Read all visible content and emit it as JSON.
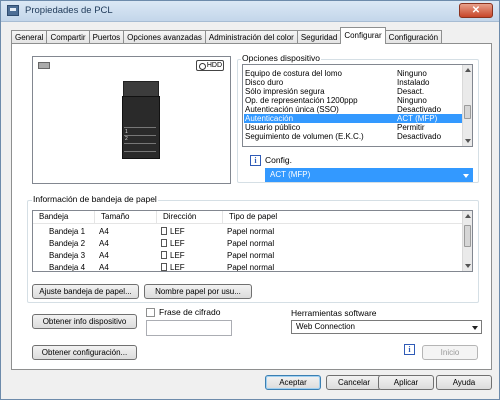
{
  "window": {
    "title": "Propiedades de PCL",
    "close_glyph": "✕"
  },
  "tabs": [
    {
      "label": "General"
    },
    {
      "label": "Compartir"
    },
    {
      "label": "Puertos"
    },
    {
      "label": "Opciones avanzadas"
    },
    {
      "label": "Administración del color"
    },
    {
      "label": "Seguridad"
    },
    {
      "label": "Configurar",
      "active": true
    },
    {
      "label": "Configuración"
    }
  ],
  "device_preview": {
    "hdd_badge": "HDD",
    "icons": [
      "printer-image",
      "hdd-icon"
    ]
  },
  "device_options": {
    "group_label": "Opciones dispositivo",
    "rows": [
      {
        "name": "Equipo de costura del lomo",
        "value": "Ninguno"
      },
      {
        "name": "Disco duro",
        "value": "Instalado"
      },
      {
        "name": "Sólo impresión segura",
        "value": "Desact."
      },
      {
        "name": "Op. de representación 1200ppp",
        "value": "Ninguno"
      },
      {
        "name": "Autenticación única (SSO)",
        "value": "Desactivado"
      },
      {
        "name": "Autenticación",
        "value": "ACT (MFP)",
        "selected": true
      },
      {
        "name": "Usuario público",
        "value": "Permitir"
      },
      {
        "name": "Seguimiento de volumen (E.K.C.)",
        "value": "Desactivado"
      }
    ],
    "config_label": "Config.",
    "config_value": "ACT (MFP)"
  },
  "paper_tray": {
    "group_label": "Información de bandeja de papel",
    "columns": [
      "Bandeja",
      "Tamaño",
      "Dirección",
      "Tipo de papel"
    ],
    "rows": [
      {
        "tray": "Bandeja 1",
        "size": "A4",
        "direction": "LEF",
        "type": "Papel normal"
      },
      {
        "tray": "Bandeja 2",
        "size": "A4",
        "direction": "LEF",
        "type": "Papel normal"
      },
      {
        "tray": "Bandeja 3",
        "size": "A4",
        "direction": "LEF",
        "type": "Papel normal"
      },
      {
        "tray": "Bandeja 4",
        "size": "A4",
        "direction": "LEF",
        "type": "Papel normal"
      }
    ],
    "adjust_button": "Ajuste bandeja de papel...",
    "paper_name_button": "Nombre papel por usu..."
  },
  "device_info_button": "Obtener info dispositivo",
  "encryption": {
    "label": "Frase de cifrado",
    "value": ""
  },
  "software_tools": {
    "label": "Herramientas software",
    "selected": "Web Connection"
  },
  "get_config_button": "Obtener configuración...",
  "start_button": "Inicio",
  "footer": {
    "ok": "Aceptar",
    "cancel": "Cancelar",
    "apply": "Aplicar",
    "help": "Ayuda"
  },
  "colors": {
    "selection": "#3399ff",
    "title_text": "#1e3958",
    "info_icon": "#2f5bb7"
  }
}
